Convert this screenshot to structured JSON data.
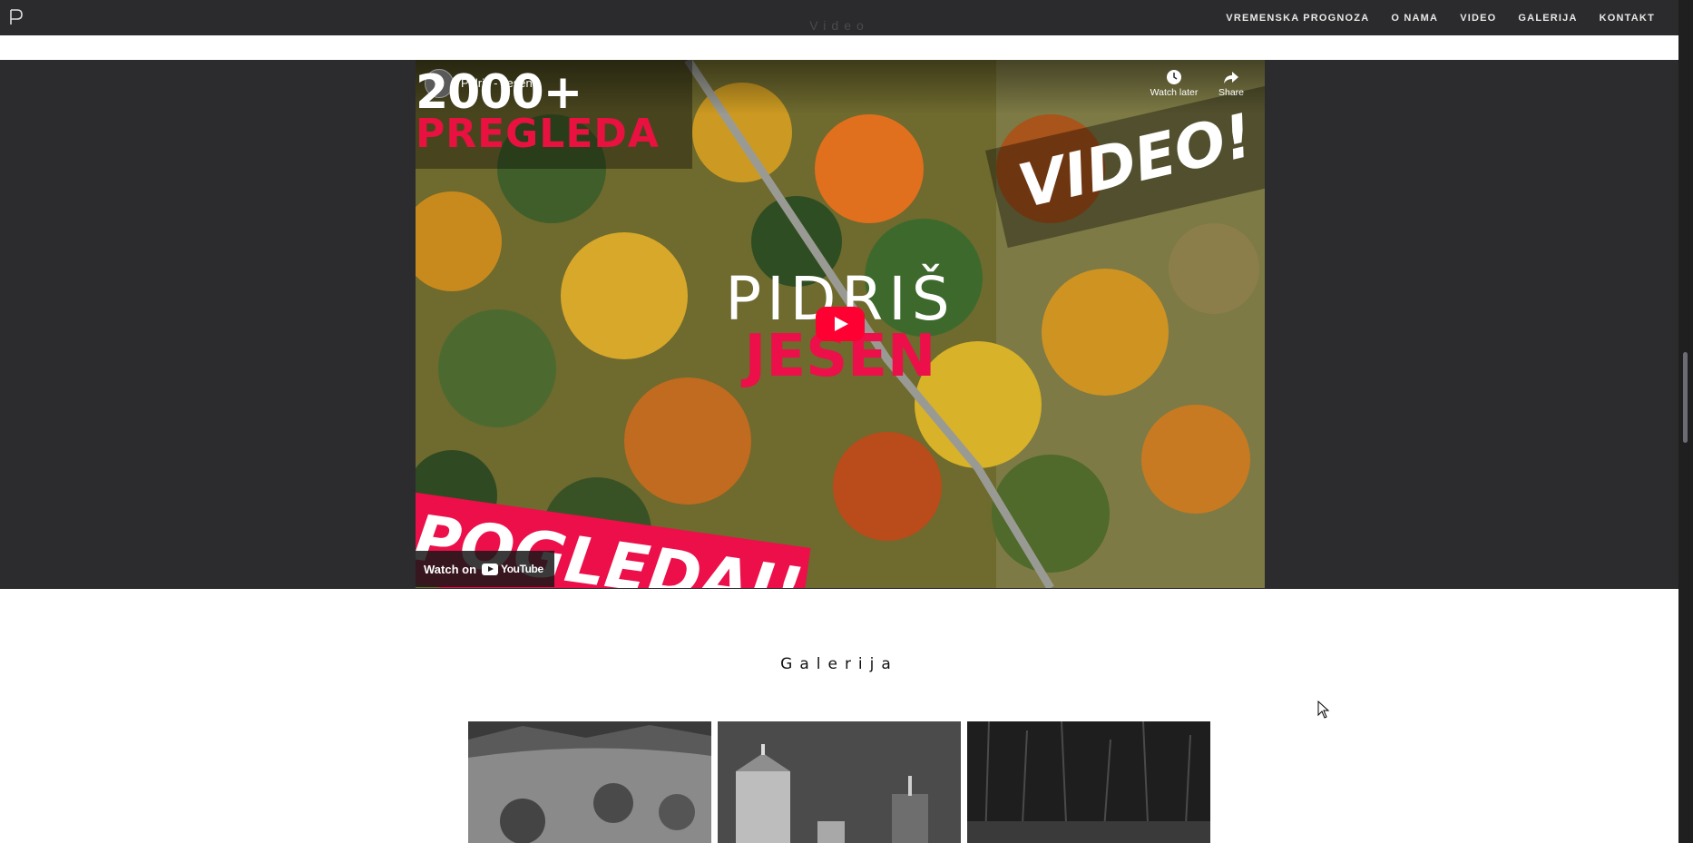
{
  "nav": {
    "logo_letter": "P",
    "ghost_section_title": "Video",
    "items": [
      "VREMENSKA PROGNOZA",
      "O NAMA",
      "VIDEO",
      "GALERIJA",
      "KONTAKT"
    ]
  },
  "video": {
    "title": "Pidriš - Jesen",
    "watch_later": "Watch later",
    "share": "Share",
    "thumb_count": "2000+",
    "thumb_views": "PREGLEDA",
    "thumb_tag": "VIDEO!",
    "thumb_name": "PIDRIŠ",
    "thumb_season": "JESEN",
    "thumb_cta": "POGLEDAJ!",
    "watch_on": "Watch on",
    "youtube": "YouTube"
  },
  "gallery": {
    "title": "Galerija"
  },
  "colors": {
    "accent": "#ec0f49",
    "nav_bg": "#2b2b2d",
    "section_bg": "#2c2c2e"
  }
}
